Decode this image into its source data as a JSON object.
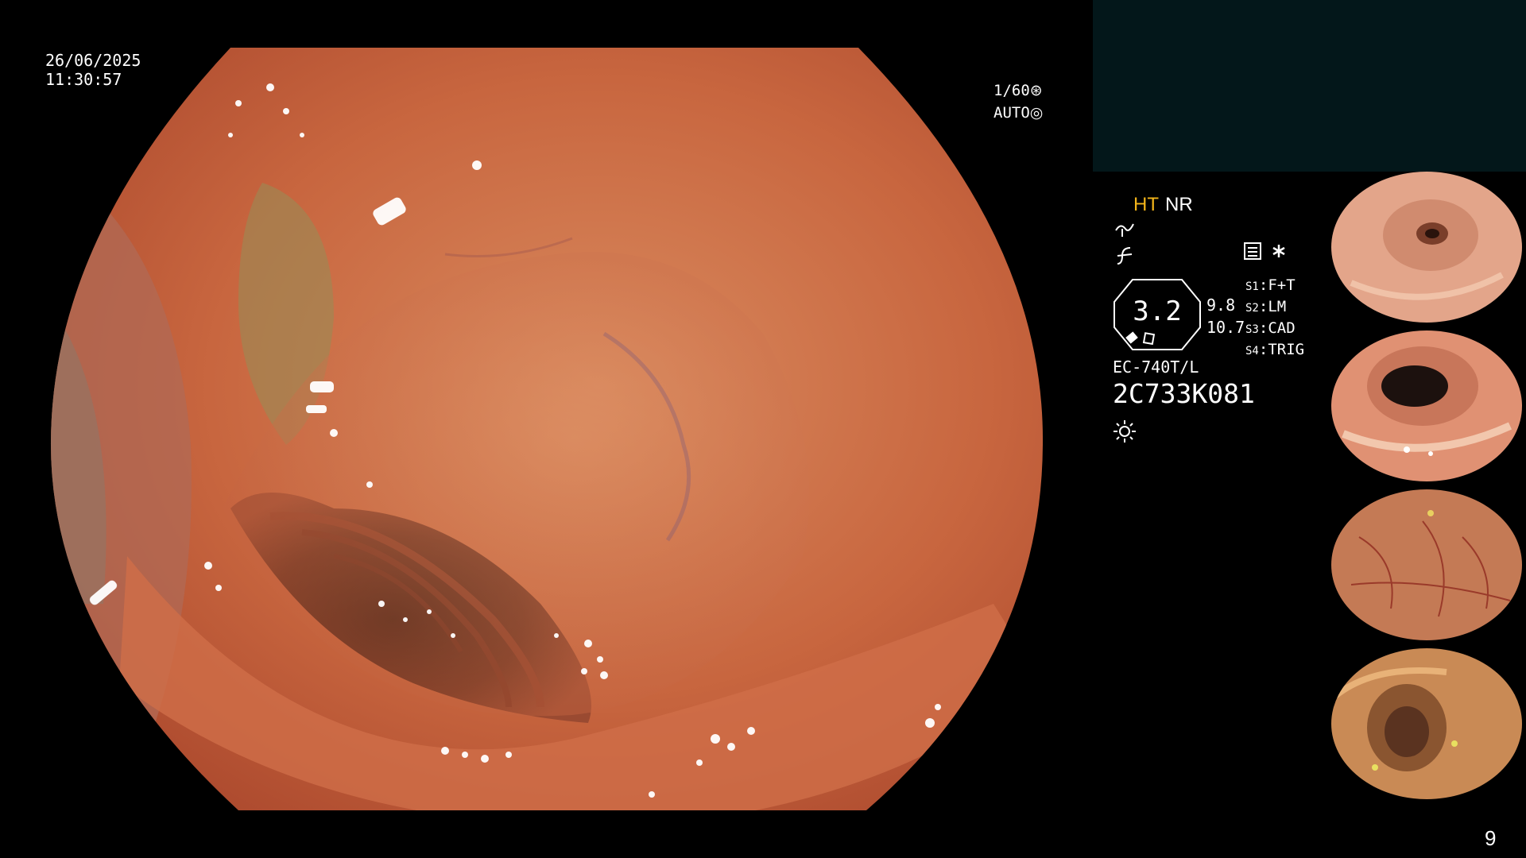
{
  "overlay": {
    "date": "26/06/2025",
    "time": "11:30:57",
    "shutter": "1/60",
    "shutter_symbol": "⊛",
    "exposure": "AUTO",
    "exposure_symbol": "◎"
  },
  "status": {
    "ht": "HT",
    "nr": "NR"
  },
  "zoom": {
    "value": "3.2",
    "num_top": "9.8",
    "num_bottom": "10.7"
  },
  "scope": {
    "model": "EC-740T/L",
    "serial": "2C733K081"
  },
  "scope_buttons": [
    {
      "key": "S1",
      "value": "F+T"
    },
    {
      "key": "S2",
      "value": "LM"
    },
    {
      "key": "S3",
      "value": "CAD"
    },
    {
      "key": "S4",
      "value": "TRIG"
    }
  ],
  "thumbnails": [
    {
      "label": "thumbnail-1"
    },
    {
      "label": "thumbnail-2"
    },
    {
      "label": "thumbnail-3"
    },
    {
      "label": "thumbnail-4"
    }
  ],
  "page_number": "9",
  "colors": {
    "mucosa": "#c4603f",
    "lumen": "#3a1a12",
    "ht_accent": "#f2b41a",
    "panel": "#03171a"
  }
}
